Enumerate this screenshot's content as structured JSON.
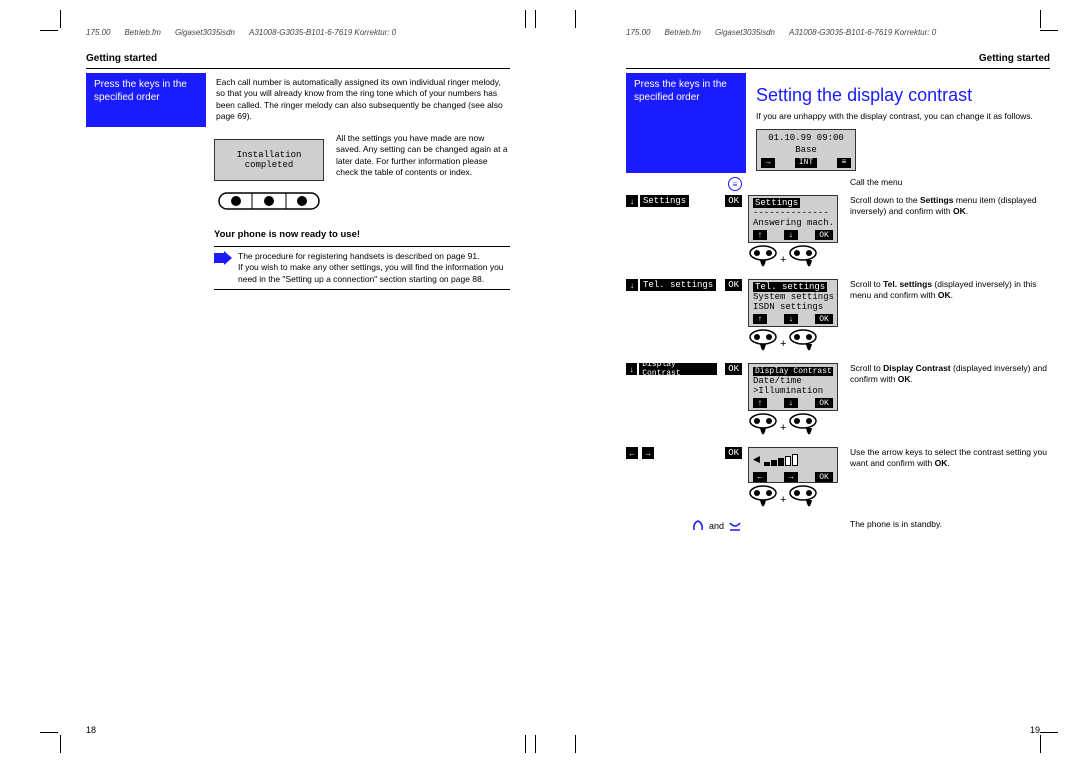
{
  "header": {
    "p1": "175.00",
    "p2": "Betrieb.fm",
    "p3": "Gigaset3035isdn",
    "p4": "A31008-G3035-B101-6-7619  Korrektur: 0"
  },
  "left_page": {
    "section_title": "Getting started",
    "blue_instruction": "Press the keys in the specified order",
    "para1": "Each call number is automatically assigned its own individual ringer melody, so that you will already know from the ring tone which of your numbers has been called. The ringer melody can also subsequently be changed (see also page 69).",
    "lcd": {
      "line1": "Installation",
      "line2": "completed"
    },
    "para2": "All the settings you have made are now saved. Any setting can be changed again at a later date. For further information please check the table of contents or index.",
    "ready_title": "Your phone is now ready to use!",
    "note1": "The procedure for registering handsets is described on page 91.",
    "note2": "If you wish to make any other settings, you will find the information you need in the \"Setting up a connection\" section starting on page 88.",
    "pagenum": "18"
  },
  "right_page": {
    "section_title": "Getting started",
    "blue_instruction": "Press the keys in the specified order",
    "heading": "Setting the display contrast",
    "intro": "If you are unhappy with the display contrast, you can change it as follows.",
    "idle_display": {
      "line1": "01.10.99  09:00",
      "line2": "Base",
      "int": "INT"
    },
    "menu_desc": "Call the menu",
    "step_settings": {
      "label": "Settings",
      "ok": "OK",
      "lcd": {
        "l1": "Settings",
        "l2": "--------------",
        "l3": "Answering mach."
      },
      "desc_a": "Scroll down to the ",
      "desc_b": "Settings",
      "desc_c": " menu item (displayed inversely) and confirm with ",
      "desc_d": "OK",
      "desc_e": "."
    },
    "step_tel": {
      "label": "Tel. settings",
      "ok": "OK",
      "lcd": {
        "l1": "Tel. settings",
        "l2": "System settings",
        "l3": "ISDN settings"
      },
      "desc_a": "Scroll to ",
      "desc_b": "Tel. settings",
      "desc_c": " (displayed inversely) in this menu and confirm with ",
      "desc_d": "OK",
      "desc_e": "."
    },
    "step_contrast": {
      "label": "Display Contrast",
      "ok": "OK",
      "lcd": {
        "l1": "Display Contrast",
        "l2": " Date/time",
        "l3": ">Illumination"
      },
      "desc_a": "Scroll to ",
      "desc_b": "Display Contrast",
      "desc_c": " (displayed inversely) and confirm with ",
      "desc_d": "OK",
      "desc_e": "."
    },
    "step_arrows": {
      "ok": "OK",
      "desc": "Use the arrow keys to select the contrast setting you want and confirm with ",
      "desc_b": "OK",
      "desc_c": "."
    },
    "standby": {
      "and": "and",
      "desc": "The phone is in standby."
    },
    "pagenum": "19"
  }
}
